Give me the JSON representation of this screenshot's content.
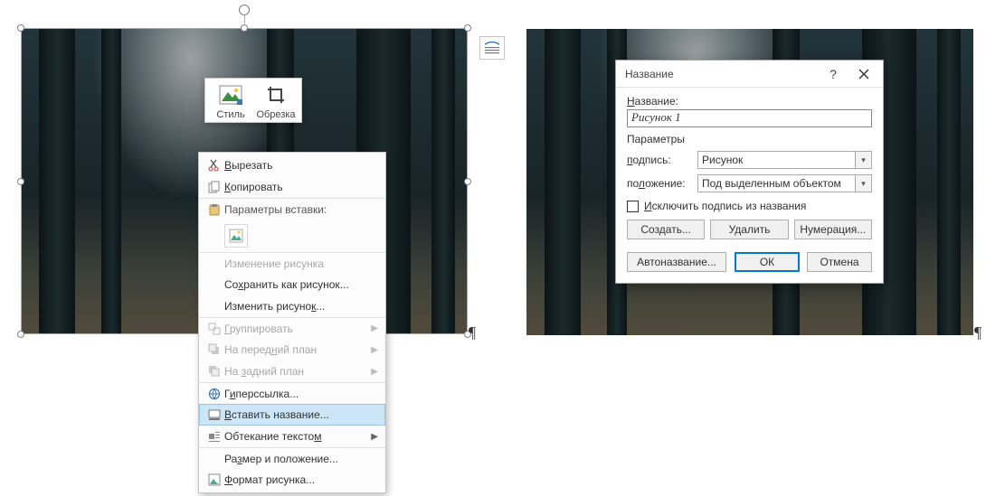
{
  "mini_toolbar": {
    "style": "Стиль",
    "crop": "Обрезка"
  },
  "context_menu": {
    "cut": "Вырезать",
    "copy": "Копировать",
    "paste_header": "Параметры вставки:",
    "change_image": "Изменение рисунка",
    "save_as_image": "Сохранить как рисунок...",
    "edit_image": "Изменить рисунок...",
    "group": "Группировать",
    "bring_front": "На передний план",
    "send_back": "На задний план",
    "hyperlink": "Гиперссылка...",
    "insert_caption": "Вставить название...",
    "text_wrap": "Обтекание текстом",
    "size_position": "Размер и положение...",
    "format_picture": "Формат рисунка..."
  },
  "dialog": {
    "title": "Название",
    "field_label": "Название:",
    "field_value": "Рисунок 1",
    "section": "Параметры",
    "label_kind": "подпись:",
    "kind_value": "Рисунок",
    "label_pos": "положение:",
    "pos_value": "Под выделенным объектом",
    "exclude": "Исключить подпись из названия",
    "btn_create": "Создать...",
    "btn_delete": "Удалить",
    "btn_numbering": "Нумерация...",
    "btn_auto": "Автоназвание...",
    "btn_ok": "ОК",
    "btn_cancel": "Отмена"
  },
  "marks": {
    "pilcrow": "¶"
  }
}
